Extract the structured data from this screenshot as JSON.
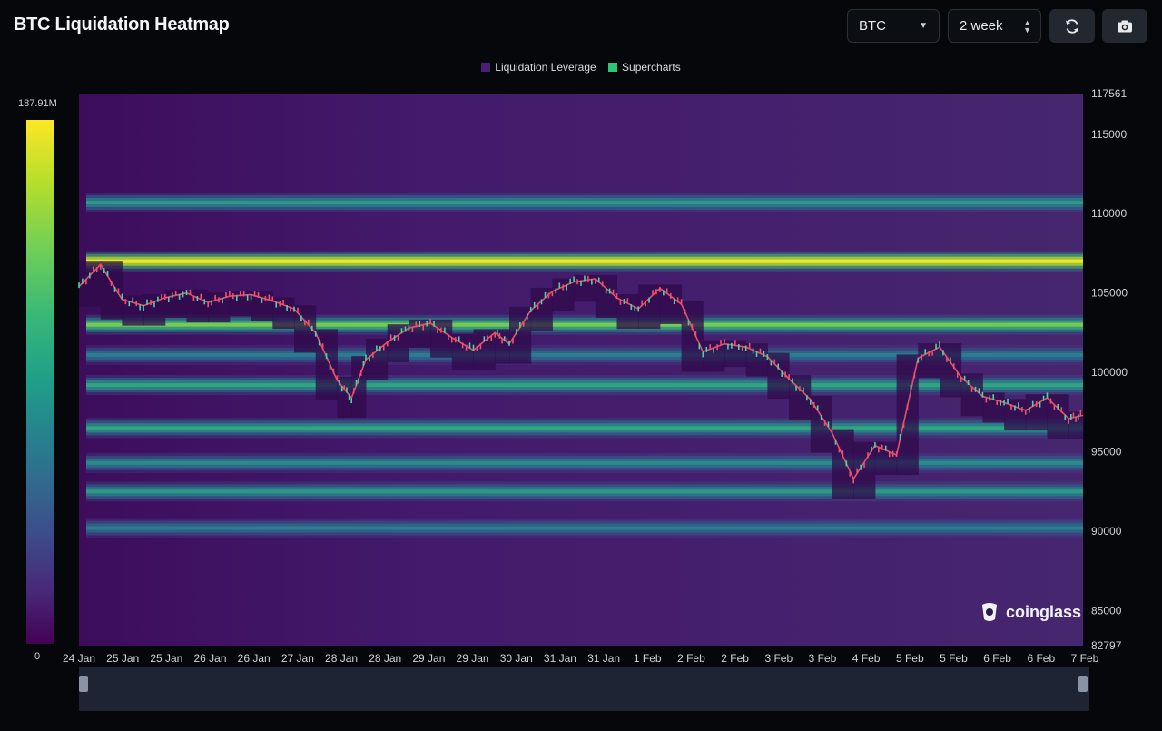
{
  "header": {
    "title": "BTC Liquidation Heatmap",
    "symbol": "BTC",
    "range": "2 week",
    "refresh_icon": "refresh-icon",
    "camera_icon": "camera-icon"
  },
  "legend": [
    {
      "label": "Liquidation Leverage",
      "color": "#4b1f73"
    },
    {
      "label": "Supercharts",
      "color": "#2ec47a"
    }
  ],
  "colorbar": {
    "max_label": "187.91M",
    "min_label": "0"
  },
  "watermark": "coinglass",
  "chart_data": {
    "type": "heatmap",
    "title": "",
    "xlabel": "",
    "ylabel": "",
    "x_tick_labels": [
      "24 Jan",
      "25 Jan",
      "25 Jan",
      "26 Jan",
      "26 Jan",
      "27 Jan",
      "28 Jan",
      "28 Jan",
      "29 Jan",
      "29 Jan",
      "30 Jan",
      "31 Jan",
      "31 Jan",
      "1 Feb",
      "2 Feb",
      "2 Feb",
      "3 Feb",
      "3 Feb",
      "4 Feb",
      "5 Feb",
      "5 Feb",
      "6 Feb",
      "6 Feb",
      "7 Feb"
    ],
    "y_tick_labels": [
      "117561",
      "115000",
      "110000",
      "105000",
      "100000",
      "95000",
      "90000",
      "85000",
      "82797"
    ],
    "y_ticks": [
      117561,
      115000,
      110000,
      105000,
      100000,
      95000,
      90000,
      85000,
      82797
    ],
    "ylim": [
      82797,
      117561
    ],
    "colorscale": [
      "#440154",
      "#3e4989",
      "#26828e",
      "#35b779",
      "#b5de2b",
      "#fde725"
    ],
    "value_range": [
      "0",
      "187.91M"
    ],
    "price_series": {
      "name": "",
      "x_days": [
        0,
        0.3,
        0.6,
        0.9,
        1.2,
        1.5,
        1.8,
        2.1,
        2.4,
        2.7,
        3.0,
        3.3,
        3.6,
        3.8,
        4.0,
        4.3,
        4.6,
        4.9,
        5.2,
        5.5,
        5.8,
        6.0,
        6.3,
        6.6,
        6.9,
        7.2,
        7.5,
        7.8,
        8.1,
        8.4,
        8.7,
        9.0,
        9.3,
        9.6,
        9.9,
        10.2,
        10.5,
        10.8,
        11.1,
        11.4,
        11.7,
        12.0,
        12.3,
        12.6,
        12.9,
        13.2,
        13.5,
        13.8,
        14.0
      ],
      "y": [
        105400,
        106800,
        104600,
        104200,
        104700,
        105000,
        104400,
        104800,
        104900,
        104500,
        104000,
        102500,
        99500,
        98400,
        100800,
        101900,
        102800,
        103100,
        102200,
        101400,
        102500,
        101800,
        103900,
        105100,
        105700,
        105900,
        104700,
        104000,
        105300,
        104300,
        101300,
        101800,
        101600,
        101000,
        99600,
        98300,
        96200,
        93300,
        95400,
        94800,
        100900,
        101600,
        99700,
        98500,
        98100,
        97600,
        98400,
        97100,
        97300
      ]
    },
    "bands": [
      {
        "level": 107000,
        "intensity": 1.0
      },
      {
        "level": 103000,
        "intensity": 0.72
      },
      {
        "level": 110700,
        "intensity": 0.5
      },
      {
        "level": 99200,
        "intensity": 0.55
      },
      {
        "level": 96500,
        "intensity": 0.55
      },
      {
        "level": 92500,
        "intensity": 0.5
      },
      {
        "level": 90200,
        "intensity": 0.4
      },
      {
        "level": 101100,
        "intensity": 0.4
      },
      {
        "level": 94300,
        "intensity": 0.45
      }
    ]
  }
}
